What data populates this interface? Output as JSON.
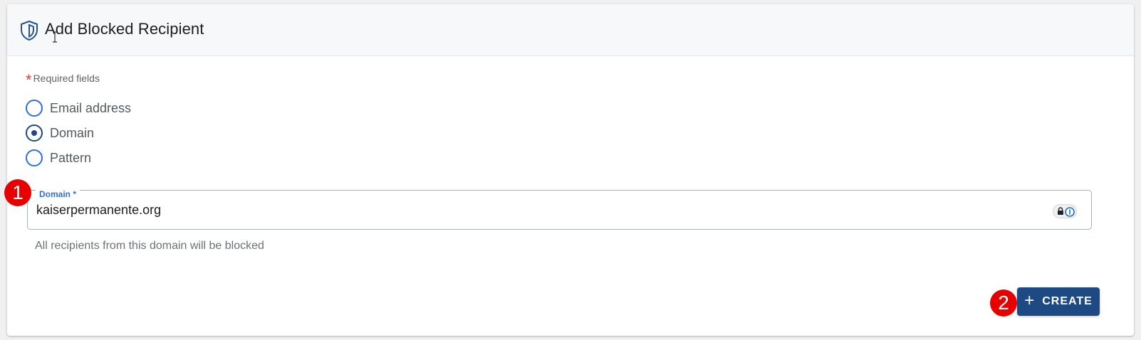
{
  "header": {
    "title": "Add Blocked Recipient",
    "icon": "shield-icon"
  },
  "form": {
    "required_note": "Required fields",
    "required_mark": "*",
    "recipient_type": {
      "options": [
        {
          "label": "Email address",
          "selected": false
        },
        {
          "label": "Domain",
          "selected": true
        },
        {
          "label": "Pattern",
          "selected": false
        }
      ]
    },
    "domain_field": {
      "label": "Domain *",
      "value": "kaiserpermanente.org",
      "helper": "All recipients from this domain will be blocked"
    },
    "create_button": {
      "label": "CREATE",
      "icon": "plus-icon"
    }
  },
  "annotations": {
    "badge_1": "1",
    "badge_2": "2"
  },
  "colors": {
    "accent": "#2f6fd6",
    "button": "#1e4a84",
    "required": "#e53935",
    "badge": "#e60000"
  }
}
